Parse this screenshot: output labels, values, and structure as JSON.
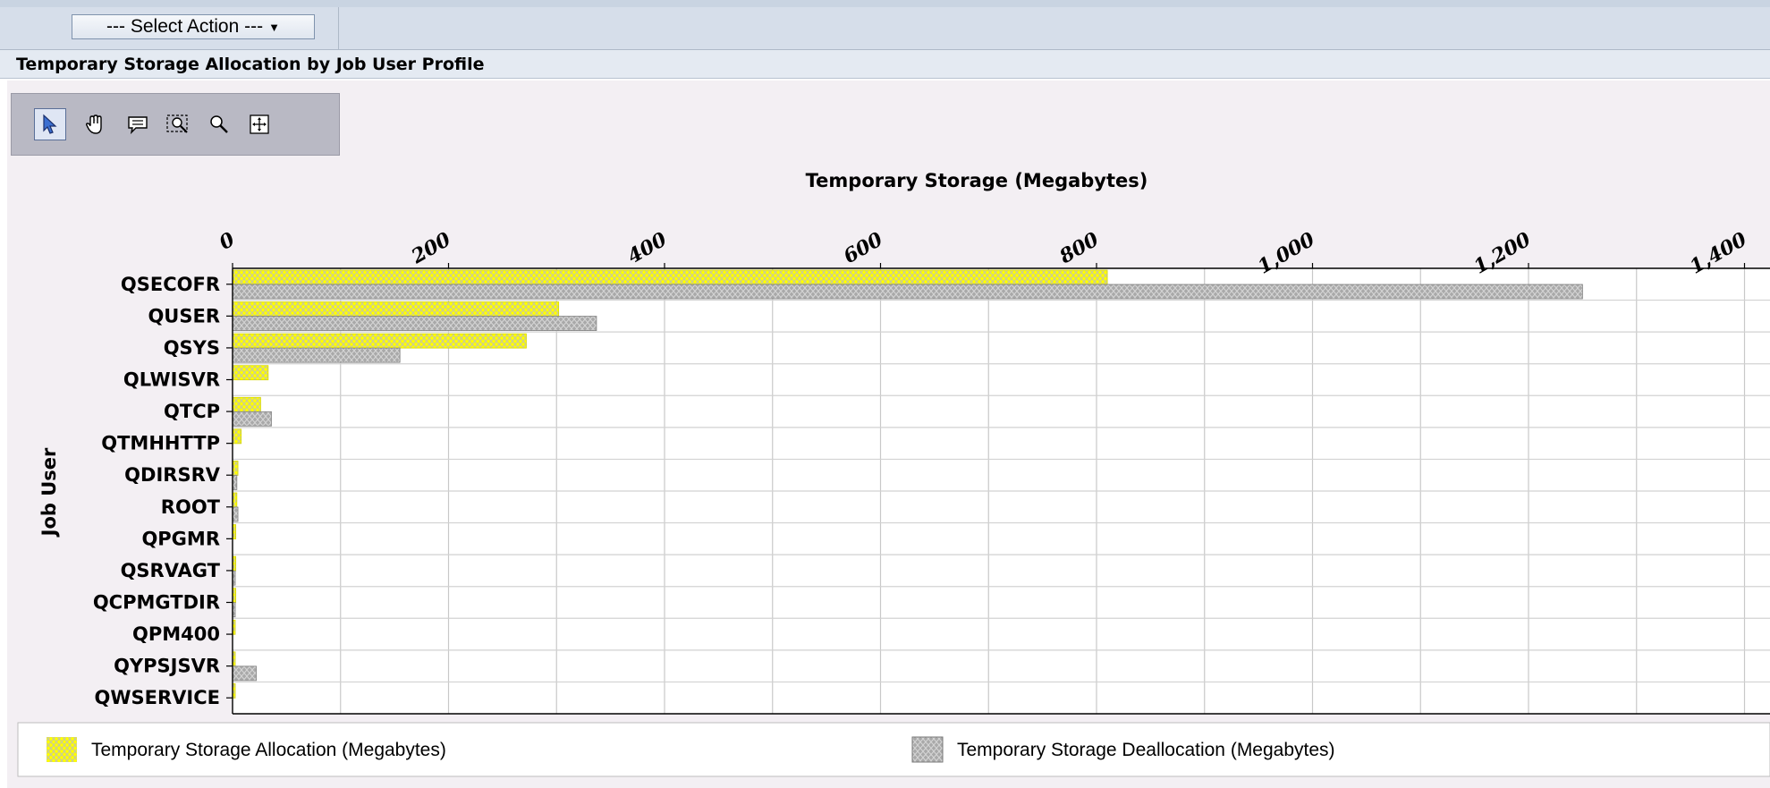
{
  "toolbar": {
    "select_action_label": "--- Select Action ---"
  },
  "panel": {
    "title": "Temporary Storage Allocation by Job User Profile"
  },
  "tools": [
    {
      "name": "pointer-icon",
      "active": true
    },
    {
      "name": "hand-pan-icon",
      "active": false
    },
    {
      "name": "comment-icon",
      "active": false
    },
    {
      "name": "zoom-box-icon",
      "active": false
    },
    {
      "name": "zoom-out-icon",
      "active": false
    },
    {
      "name": "crosshair-icon",
      "active": false
    }
  ],
  "chart_data": {
    "type": "bar",
    "orientation": "horizontal",
    "title": "Temporary Storage (Megabytes)",
    "xlabel": "Temporary Storage (Megabytes)",
    "ylabel": "Job User",
    "xlim": [
      0,
      1400
    ],
    "ticks": [
      "0",
      "200",
      "400",
      "600",
      "800",
      "1,000",
      "1,200",
      "1,400"
    ],
    "grid": true,
    "legend_position": "bottom",
    "categories": [
      "QSECOFR",
      "QUSER",
      "QSYS",
      "QLWISVR",
      "QTCP",
      "QTMHHTTP",
      "QDIRSRV",
      "ROOT",
      "QPGMR",
      "QSRVAGT",
      "QCPMGTDIR",
      "QPM400",
      "QYPSJSVR",
      "QWSERVICE"
    ],
    "series": [
      {
        "name": "Temporary Storage Allocation (Megabytes)",
        "color": "#ffff00",
        "values": [
          810,
          302,
          272,
          33,
          26,
          8,
          5,
          4,
          3,
          3,
          3,
          2,
          2,
          2
        ]
      },
      {
        "name": "Temporary Storage Deallocation (Megabytes)",
        "color": "#a9a9a9",
        "values": [
          1250,
          337,
          155,
          0,
          36,
          0,
          4,
          5,
          0,
          2,
          2,
          0,
          22,
          0
        ]
      }
    ]
  }
}
